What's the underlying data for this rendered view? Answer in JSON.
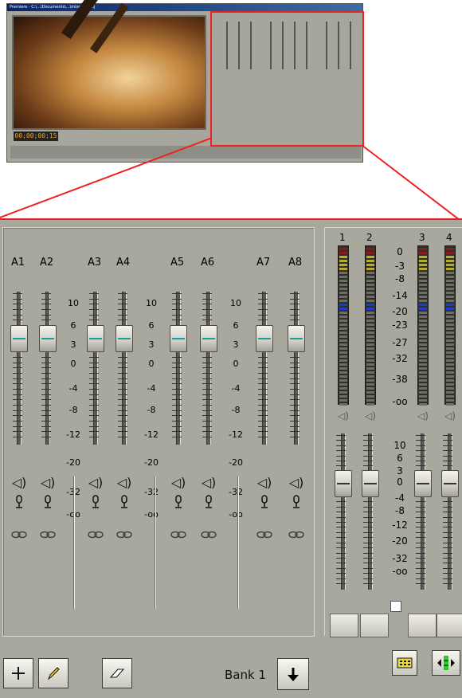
{
  "thumbnail": {
    "window_title": "Premiere - C:\\...\\Documents\\...\\mixer.prproj",
    "timecode": "00;00;00;15"
  },
  "mixer": {
    "channels": [
      "A1",
      "A2",
      "A3",
      "A4",
      "A5",
      "A6",
      "A7",
      "A8"
    ],
    "fader_scale": [
      "10",
      "6",
      "3",
      "0",
      "-4",
      "-8",
      "-12",
      "-20",
      "-32",
      "-oo"
    ],
    "meter_channels": [
      "1",
      "2",
      "3",
      "4"
    ],
    "meter_scale": [
      "0",
      "-3",
      "-8",
      "-14",
      "-20",
      "-23",
      "-27",
      "-32",
      "-38",
      "-oo"
    ],
    "master_scale": [
      "10",
      "6",
      "3",
      "0",
      "-4",
      "-8",
      "-12",
      "-20",
      "-32",
      "-oo"
    ],
    "bank_label": "Bank 1"
  },
  "colors": {
    "highlight": "#e22222",
    "fader_marker": "#18a0a0",
    "meter_red": "#8b1a1a",
    "meter_yellow": "#b8ad2a",
    "meter_blue": "#1a3dcc",
    "meter_gray": "#6d6d66",
    "panel_bg": "#a9a89e"
  },
  "icons": {
    "speaker": "speaker-icon",
    "mic": "microphone-icon",
    "link": "link-icon",
    "add": "add-tool-icon",
    "pencil": "pencil-icon",
    "eraser": "eraser-icon",
    "arrow_down": "arrow-down-icon",
    "film": "film-icon",
    "meter": "meter-toggle-icon"
  }
}
